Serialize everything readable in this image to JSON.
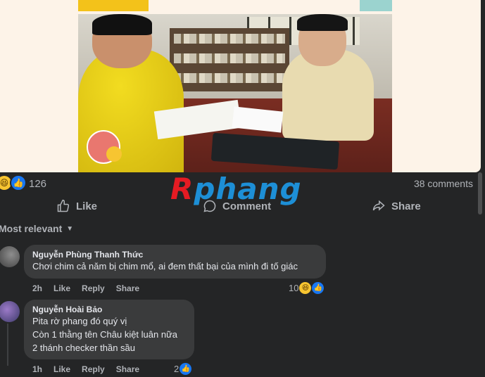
{
  "post": {
    "reaction_count": "126",
    "comments_count": "38 comments",
    "reactions": [
      "haha",
      "like"
    ]
  },
  "watermark": {
    "part1": "R",
    "part2": "phang"
  },
  "actions": {
    "like": "Like",
    "comment": "Comment",
    "share": "Share"
  },
  "sort": {
    "label": "Most relevant"
  },
  "comments": [
    {
      "author": "Nguyễn Phùng Thanh Thức",
      "lines": [
        "Chơi chim cả năm bị chim mổ, ai đem thất bại của mình đi tố giác"
      ],
      "time": "2h",
      "like": "Like",
      "reply": "Reply",
      "share": "Share",
      "reaction_count": "10"
    },
    {
      "author": "Nguyễn Hoài Bảo",
      "lines": [
        "Pita rờ phang đó quý vị",
        "Còn 1 thằng tên Châu kiệt luân nữa",
        "2 thánh checker thần sầu"
      ],
      "time": "1h",
      "like": "Like",
      "reply": "Reply",
      "share": "Share",
      "reaction_count": "2"
    }
  ],
  "colors": {
    "background": "#242526",
    "bubble": "#3a3b3c",
    "text_primary": "#e4e6eb",
    "text_secondary": "#b0b3b8",
    "like_blue": "#1877f2",
    "haha_yellow": "#f7c531",
    "watermark_red": "#e51b23",
    "watermark_blue": "#1d8fd6"
  }
}
